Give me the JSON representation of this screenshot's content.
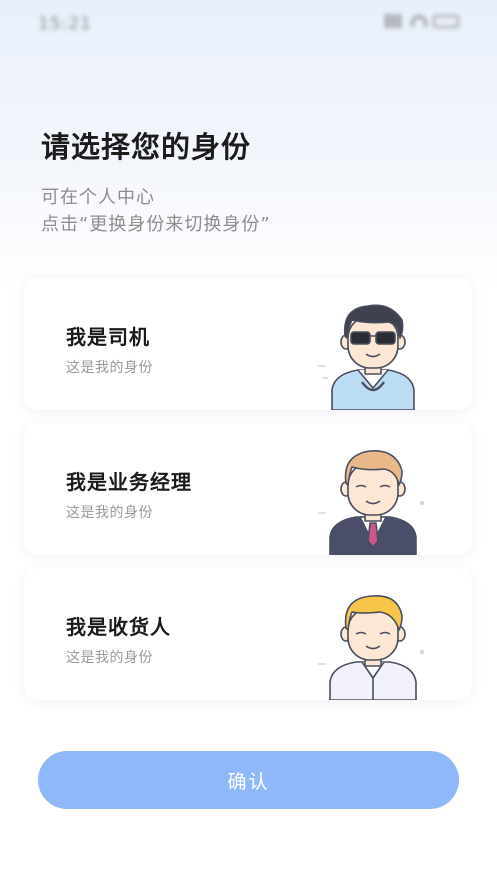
{
  "status_bar": {
    "time": "15:21"
  },
  "header": {
    "title": "请选择您的身份",
    "subtitle_line1": "可在个人中心",
    "subtitle_line2": "点击“更换身份来切换身份”"
  },
  "roles": [
    {
      "title": "我是司机",
      "description": "这是我的身份",
      "avatar": "driver-avatar-icon"
    },
    {
      "title": "我是业务经理",
      "description": "这是我的身份",
      "avatar": "manager-avatar-icon"
    },
    {
      "title": "我是收货人",
      "description": "这是我的身份",
      "avatar": "consignee-avatar-icon"
    }
  ],
  "confirm_label": "确认",
  "colors": {
    "button": "#8fb7fb",
    "driver_shirt": "#bcdcf3",
    "manager_suit": "#4a4e6a",
    "manager_tie": "#c9578a",
    "consignee_hair": "#f7c54a",
    "skin": "#fbe7d3"
  }
}
